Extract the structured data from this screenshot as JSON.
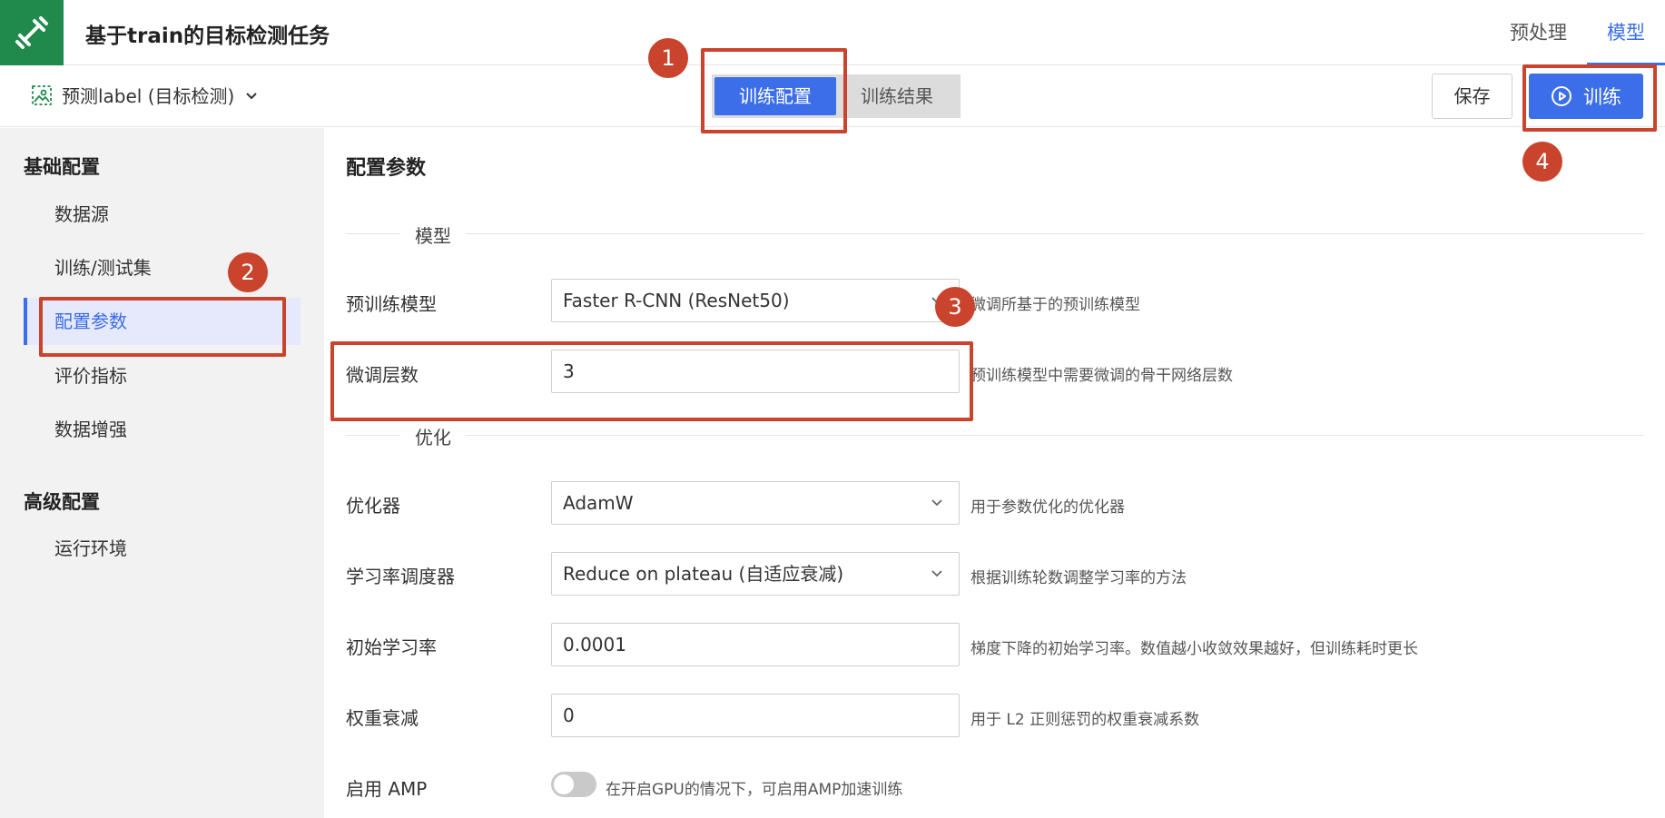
{
  "header": {
    "title": "基于train的目标检测任务",
    "tabs": [
      {
        "label": "预处理",
        "active": false
      },
      {
        "label": "模型",
        "active": true
      }
    ]
  },
  "subbar": {
    "task_selector": "预测label (目标检测)",
    "segments": [
      {
        "label": "训练配置",
        "active": true
      },
      {
        "label": "训练结果",
        "active": false
      }
    ],
    "save_label": "保存",
    "train_label": "训练"
  },
  "sidebar": {
    "groups": [
      {
        "title": "基础配置",
        "items": [
          "数据源",
          "训练/测试集",
          "配置参数",
          "评价指标",
          "数据增强"
        ]
      },
      {
        "title": "高级配置",
        "items": [
          "运行环境"
        ]
      }
    ],
    "active_item": "配置参数"
  },
  "main": {
    "title": "配置参数",
    "sections": {
      "model": "模型",
      "optimization": "优化"
    },
    "fields": {
      "pretrained_model": {
        "label": "预训练模型",
        "value": "Faster R-CNN (ResNet50)",
        "hint": "微调所基于的预训练模型"
      },
      "finetune_layers": {
        "label": "微调层数",
        "value": "3",
        "hint": "预训练模型中需要微调的骨干网络层数"
      },
      "optimizer": {
        "label": "优化器",
        "value": "AdamW",
        "hint": "用于参数优化的优化器"
      },
      "lr_scheduler": {
        "label": "学习率调度器",
        "value": "Reduce on plateau (自适应衰减)",
        "hint": "根据训练轮数调整学习率的方法"
      },
      "initial_lr": {
        "label": "初始学习率",
        "value": "0.0001",
        "hint": "梯度下降的初始学习率。数值越小收敛效果越好，但训练耗时更长"
      },
      "weight_decay": {
        "label": "权重衰减",
        "value": "0",
        "hint": "用于 L2 正则惩罚的权重衰减系数"
      },
      "amp": {
        "label": "启用 AMP",
        "enabled": false,
        "hint": "在开启GPU的情况下，可启用AMP加速训练"
      }
    }
  },
  "annotations": [
    "1",
    "2",
    "3",
    "4"
  ],
  "colors": {
    "accent": "#3b6ee8",
    "logo_bg": "#1f8a4c",
    "annotation": "#c9432d",
    "sidebar_bg": "#f2f2f2"
  }
}
